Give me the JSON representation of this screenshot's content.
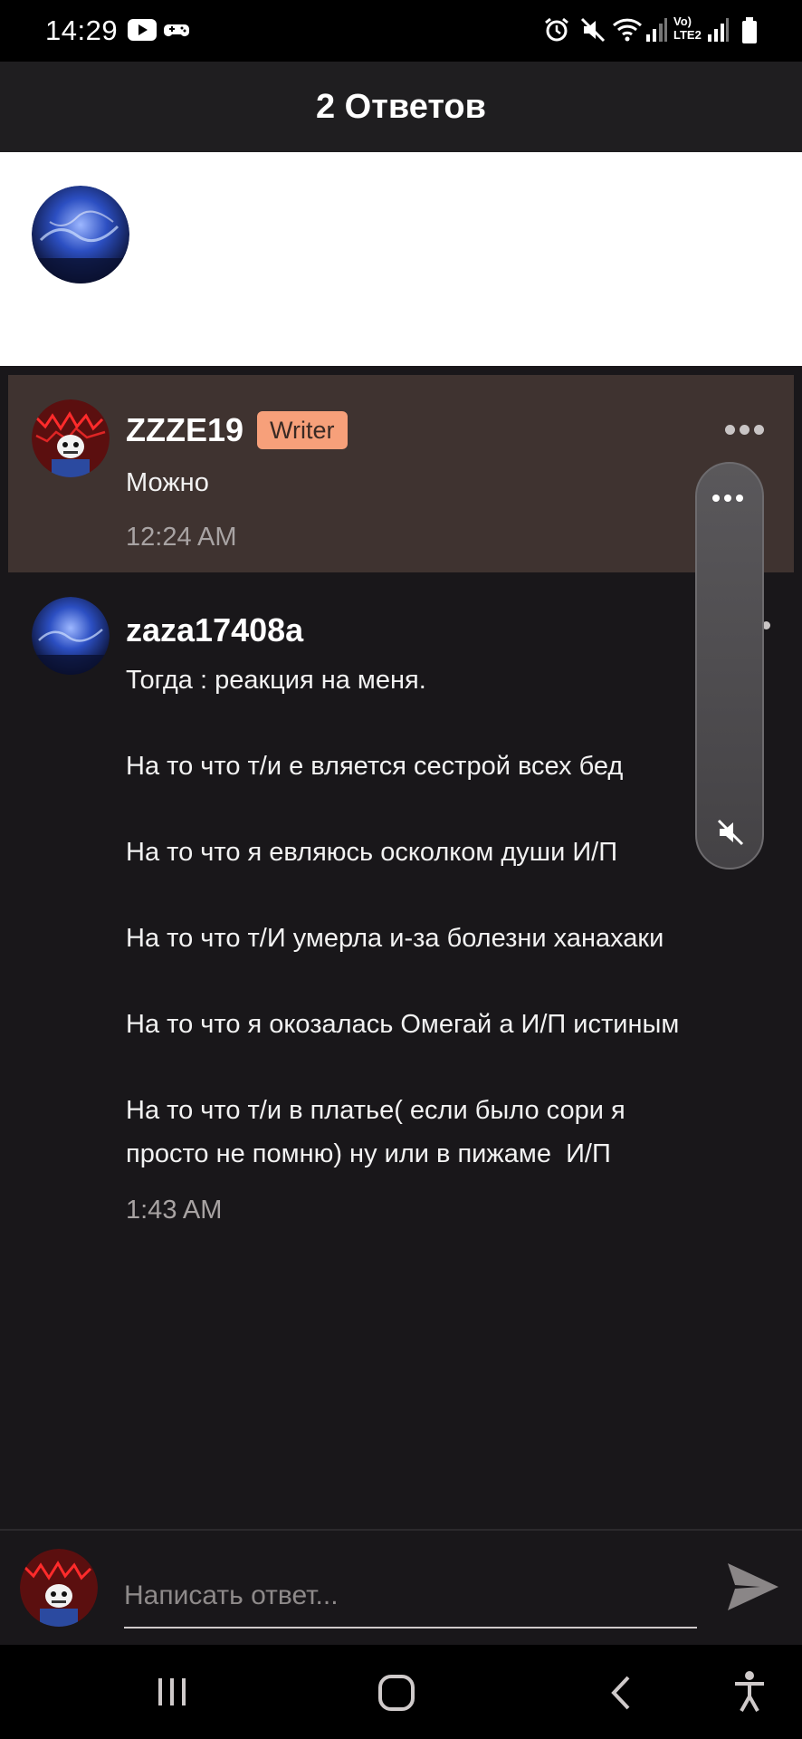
{
  "status_bar": {
    "time": "14:29",
    "icons": [
      "youtube-icon",
      "gamepad-icon",
      "alarm-icon",
      "mute-icon",
      "wifi-icon",
      "signal-icon",
      "volte-icon",
      "signal-icon",
      "battery-icon"
    ],
    "volte_label_top": "Vo)",
    "volte_label_bottom": "LTE2"
  },
  "header": {
    "title": "2 Ответов"
  },
  "comments": [
    {
      "username": "ZZZE19",
      "badge": "Writer",
      "text": "Можно",
      "time": "12:24 AM",
      "highlighted": true
    },
    {
      "username": "zaza17408a",
      "text": "Тогда : реакция на меня.\n\nНа то что т/и е вляется сестрой всех бед\n\nНа то что я евляюсь осколком души И/П\n\nНа то что т/И умерла и-за болезни ханахаки\n\nНа то что я окозалась Омегай а И/П истиным\n\nНа то что т/и в платье( если было сори я\nпросто не помню) ну или в пижаме  И/П",
      "time": "1:43 AM"
    }
  ],
  "composer": {
    "placeholder": "Написать ответ..."
  },
  "colors": {
    "accent_badge": "#f7a07a",
    "highlight_bg": "#3f3330",
    "background": "#19171a"
  }
}
